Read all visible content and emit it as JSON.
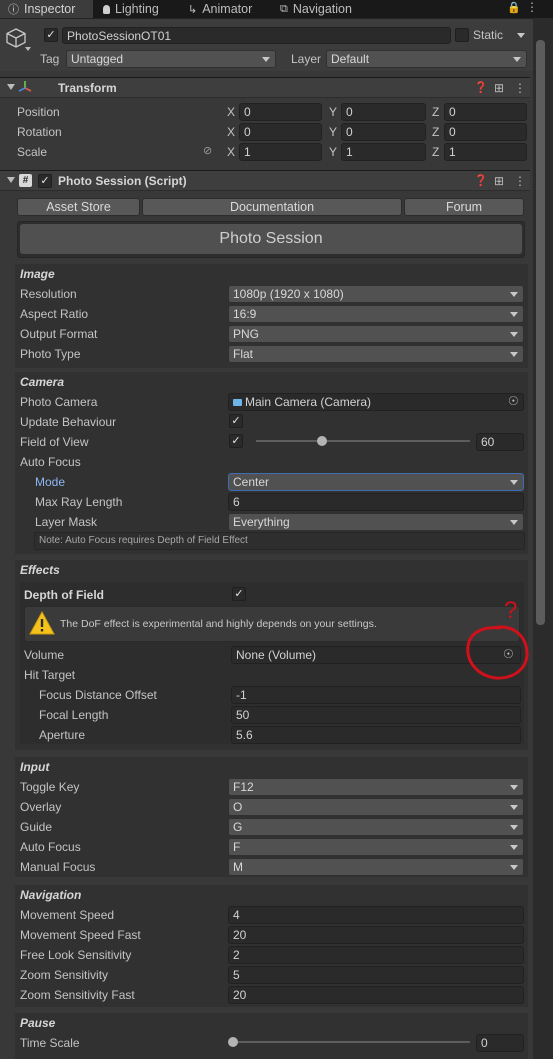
{
  "tabs": [
    {
      "label": "Inspector",
      "icon": "info-icon"
    },
    {
      "label": "Lighting",
      "icon": "bulb-icon"
    },
    {
      "label": "Animator",
      "icon": "animator-icon"
    },
    {
      "label": "Navigation",
      "icon": "navigation-icon"
    }
  ],
  "header": {
    "object_name": "PhotoSessionOT01",
    "static_label": "Static",
    "tag_label": "Tag",
    "tag_value": "Untagged",
    "layer_label": "Layer",
    "layer_value": "Default"
  },
  "transform": {
    "title": "Transform",
    "rows": [
      {
        "label": "Position",
        "x": "0",
        "y": "0",
        "z": "0"
      },
      {
        "label": "Rotation",
        "x": "0",
        "y": "0",
        "z": "0"
      },
      {
        "label": "Scale",
        "x": "1",
        "y": "1",
        "z": "1"
      }
    ],
    "axis": {
      "x": "X",
      "y": "Y",
      "z": "Z"
    }
  },
  "script": {
    "title": "Photo Session (Script)",
    "buttons": {
      "asset_store": "Asset Store",
      "documentation": "Documentation",
      "forum": "Forum"
    },
    "banner": "Photo Session"
  },
  "image": {
    "title": "Image",
    "resolution_label": "Resolution",
    "resolution": "1080p (1920 x 1080)",
    "aspect_label": "Aspect Ratio",
    "aspect": "16:9",
    "format_label": "Output Format",
    "format": "PNG",
    "type_label": "Photo Type",
    "type": "Flat"
  },
  "camera": {
    "title": "Camera",
    "photo_camera_label": "Photo Camera",
    "photo_camera": "Main Camera (Camera)",
    "update_label": "Update Behaviour",
    "fov_label": "Field of View",
    "fov": "60",
    "fov_fraction": 0.31,
    "autofocus_label": "Auto Focus",
    "mode_label": "Mode",
    "mode": "Center",
    "max_ray_label": "Max Ray Length",
    "max_ray": "6",
    "layer_mask_label": "Layer Mask",
    "layer_mask": "Everything",
    "note": "Note: Auto Focus requires Depth of Field Effect"
  },
  "effects": {
    "title": "Effects",
    "dof_label": "Depth of Field",
    "warning": "The DoF effect is experimental and highly depends on your settings.",
    "volume_label": "Volume",
    "volume": "None (Volume)",
    "hit_target_label": "Hit Target",
    "focus_offset_label": "Focus Distance Offset",
    "focus_offset": "-1",
    "focal_length_label": "Focal Length",
    "focal_length": "50",
    "aperture_label": "Aperture",
    "aperture": "5.6"
  },
  "input": {
    "title": "Input",
    "rows": [
      {
        "label": "Toggle Key",
        "value": "F12"
      },
      {
        "label": "Overlay",
        "value": "O"
      },
      {
        "label": "Guide",
        "value": "G"
      },
      {
        "label": "Auto Focus",
        "value": "F"
      },
      {
        "label": "Manual Focus",
        "value": "M"
      }
    ]
  },
  "navigation": {
    "title": "Navigation",
    "rows": [
      {
        "label": "Movement Speed",
        "value": "4"
      },
      {
        "label": "Movement Speed Fast",
        "value": "20"
      },
      {
        "label": "Free Look Sensitivity",
        "value": "2"
      },
      {
        "label": "Zoom Sensitivity",
        "value": "5"
      },
      {
        "label": "Zoom Sensitivity Fast",
        "value": "20"
      }
    ]
  },
  "pause": {
    "title": "Pause",
    "time_scale_label": "Time Scale",
    "time_scale": "0",
    "time_scale_fraction": 0.0
  },
  "annotation": {
    "mark": "?",
    "color": "#d0101a"
  },
  "colors": {
    "accent_blue": "#8cb8f0",
    "warning_yellow": "#f4c21a"
  }
}
